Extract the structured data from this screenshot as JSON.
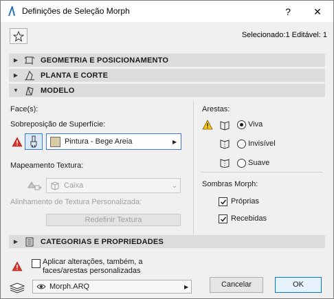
{
  "window": {
    "title": "Definições de Seleção Morph",
    "help_label": "?",
    "close_label": "✕"
  },
  "header": {
    "selection_info": "Selecionado:1 Editável: 1"
  },
  "sections": {
    "geometry": "GEOMETRIA E POSICIONAMENTO",
    "plan": "PLANTA E CORTE",
    "model": "MODELO",
    "categories": "CATEGORIAS E PROPRIEDADES"
  },
  "model": {
    "faces_label": "Face(s):",
    "surface_override_label": "Sobreposição de Superfície:",
    "surface_value": "Pintura - Bege Areia",
    "surface_color": "#d8cba6",
    "texture_mapping_label": "Mapeamento Textura:",
    "texture_value": "Caixa",
    "custom_alignment_label": "Alinhamento de Textura Personalizada:",
    "reset_texture_button": "Redefinir Textura",
    "edges_label": "Arestas:",
    "edge_options": [
      "Viva",
      "Invisível",
      "Suave"
    ],
    "edge_selected": "Viva",
    "shadows_label": "Sombras Morph:",
    "shadow_options": [
      "Próprias",
      "Recebidas"
    ],
    "shadow_checked": [
      true,
      true
    ]
  },
  "footer": {
    "apply_checkbox_label": "Aplicar alterações, também, a faces/arestas personalizadas",
    "apply_checked": false,
    "layer_value": "Morph.ARQ",
    "cancel_button": "Cancelar",
    "ok_button": "OK"
  }
}
